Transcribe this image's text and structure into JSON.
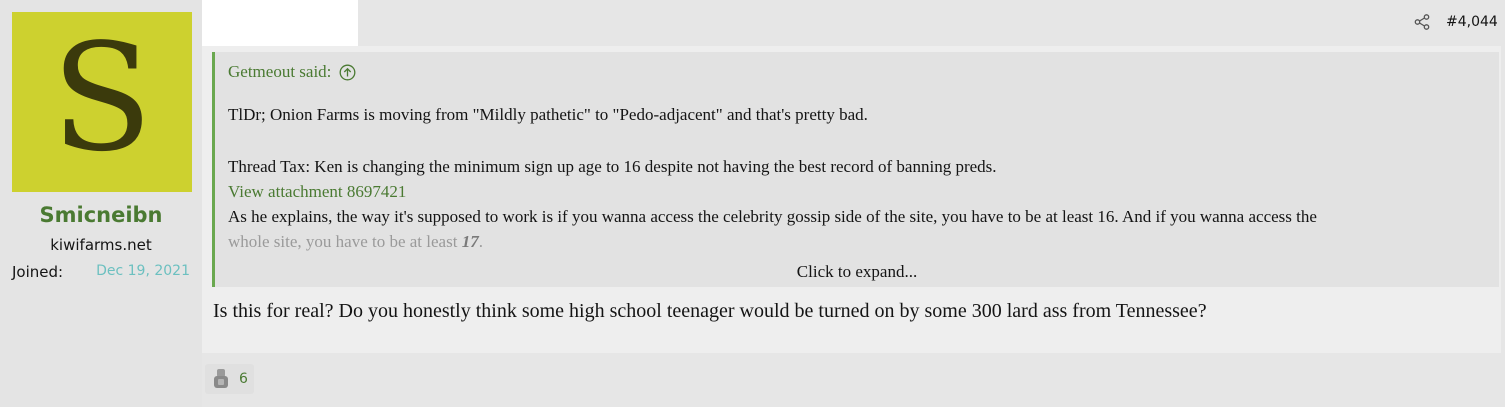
{
  "user": {
    "avatar_letter": "S",
    "avatar_color": "#cdd12f",
    "username": "Smicneibn",
    "title": "kiwifarms.net",
    "joined_label": "Joined:",
    "joined_date": "Dec 19, 2021"
  },
  "post": {
    "number": "#4,044",
    "quote": {
      "author": "Getmeout said:",
      "lines": [
        "TlDr; Onion Farms is moving from \"Mildly pathetic\" to \"Pedo-adjacent\" and that's pretty bad.",
        "Thread Tax: Ken is changing the minimum sign up age to 16 despite not having the best record of banning preds."
      ],
      "attachment": "View attachment 8697421",
      "explain_1": "As he explains, the way it's supposed to work is if you wanna access the celebrity gossip side of the site, you have to be at least 16. And if you wanna access the",
      "explain_2_prefix": "whole site, you have to be at least ",
      "explain_2_em": "17",
      "explain_2_suffix": ".",
      "expand": "Click to expand..."
    },
    "reply": "Is this for real? Do you honestly think some high school teenager would be turned on by some 300 lard ass from Tennessee?",
    "reaction_count": "6"
  },
  "icons": {
    "share": "share-icon",
    "quote_up": "arrow-up-circle-icon",
    "reaction": "reaction-icon"
  }
}
